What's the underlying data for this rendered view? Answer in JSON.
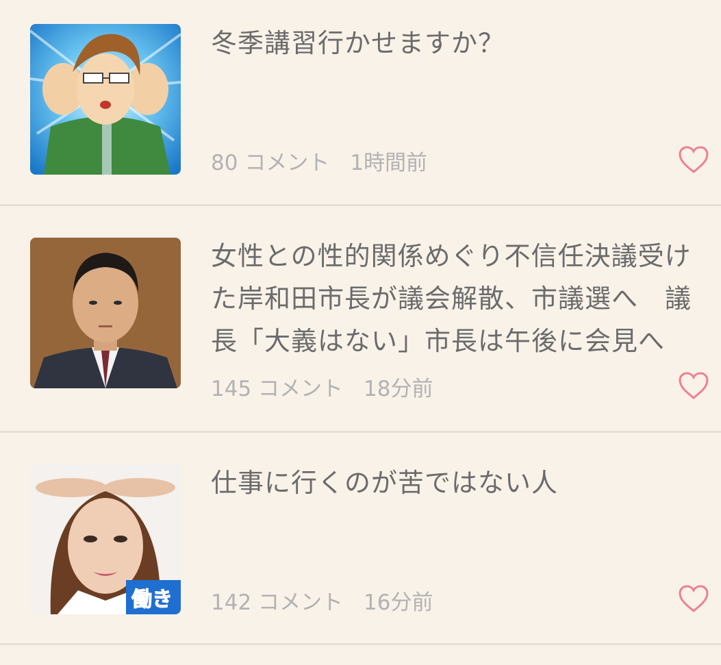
{
  "items": [
    {
      "title": "冬季講習行かせますか？",
      "comments": "80 コメント",
      "time": "1時間前",
      "thumbnail": "anime-character-glasses"
    },
    {
      "title": "女性との性的関係めぐり不信任決議受けた岸和田市長が議会解散、市議選へ　議長「大義はない」市長は午後に会見へ",
      "comments": "145 コメント",
      "time": "18分前",
      "thumbnail": "man-in-suit-portrait"
    },
    {
      "title": "仕事に行くのが苦ではない人",
      "comments": "142 コメント",
      "time": "16分前",
      "thumbnail": "woman-portrait-banner",
      "thumbnail_text": "働き"
    }
  ],
  "colors": {
    "background": "#f9f2e9",
    "title": "#6b6b6b",
    "meta": "#b2b2b2",
    "heart": "#ef7f8f",
    "divider": "#e6e0d8"
  },
  "icons": {
    "favorite": "heart-outline-icon"
  }
}
